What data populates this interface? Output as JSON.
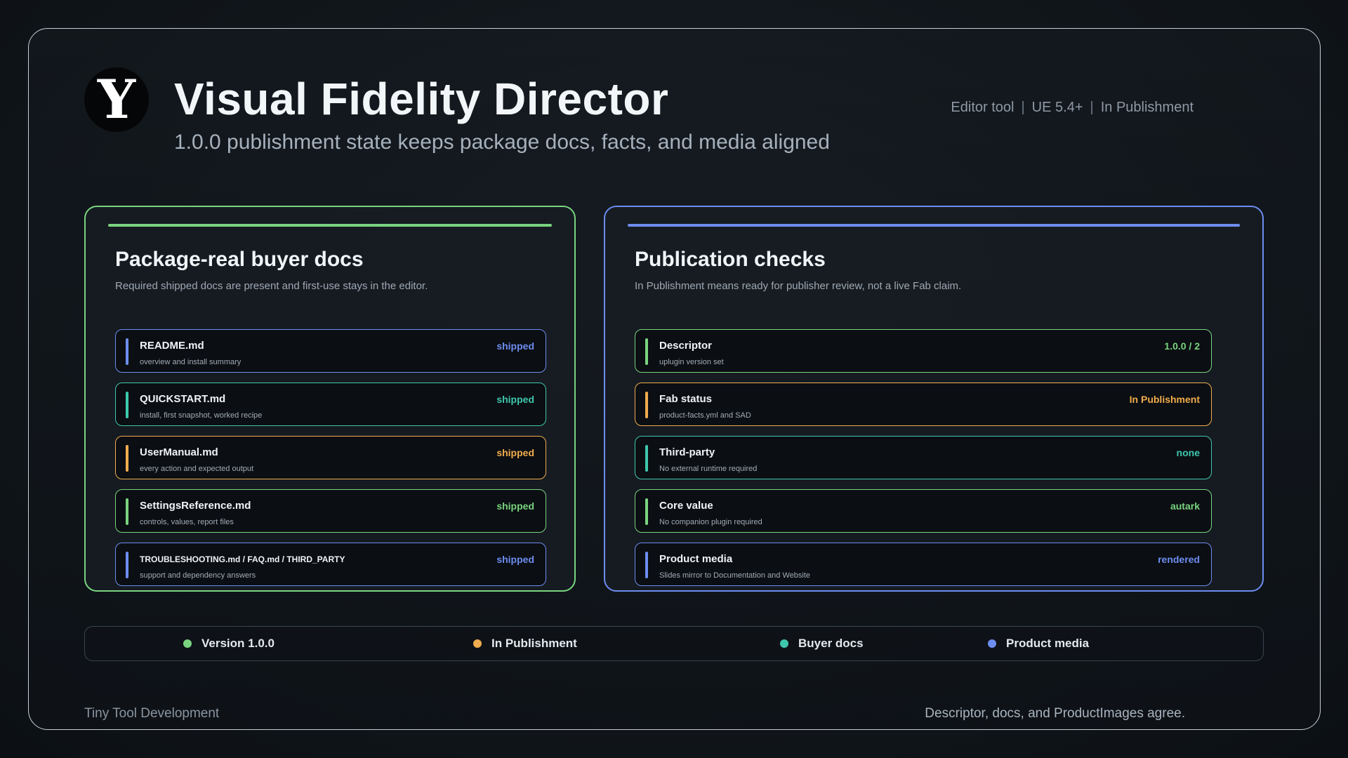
{
  "header": {
    "logo_letter": "Y",
    "title": "Visual Fidelity Director",
    "subtitle": "1.0.0 publishment state keeps package docs, facts, and media aligned",
    "meta": [
      "Editor tool",
      "UE 5.4+",
      "In Publishment"
    ],
    "meta_separator": "|"
  },
  "colors": {
    "green": "#79d47f",
    "blue": "#6d8df0",
    "orange": "#f0ac4e",
    "teal": "#3ec7ad"
  },
  "docs_panel": {
    "title": "Package-real buyer docs",
    "description": "Required shipped docs are present and first-use stays in the editor.",
    "rows": [
      {
        "name": "README.md",
        "sub": "overview and install summary",
        "status": "shipped",
        "color": "#6d8df0"
      },
      {
        "name": "QUICKSTART.md",
        "sub": "install, first snapshot, worked recipe",
        "status": "shipped",
        "color": "#3ec7ad"
      },
      {
        "name": "UserManual.md",
        "sub": "every action and expected output",
        "status": "shipped",
        "color": "#f0ac4e"
      },
      {
        "name": "SettingsReference.md",
        "sub": "controls, values, report files",
        "status": "shipped",
        "color": "#79d47f"
      },
      {
        "name": "TROUBLESHOOTING.md / FAQ.md / THIRD_PARTY",
        "sub": "support and dependency answers",
        "status": "shipped",
        "color": "#6d8df0",
        "small": true
      }
    ]
  },
  "checks_panel": {
    "title": "Publication checks",
    "description": "In Publishment means ready for publisher review, not a live Fab claim.",
    "rows": [
      {
        "name": "Descriptor",
        "sub": "uplugin version set",
        "status": "1.0.0 / 2",
        "color": "#79d47f"
      },
      {
        "name": "Fab status",
        "sub": "product-facts.yml and SAD",
        "status": "In Publishment",
        "color": "#f0ac4e"
      },
      {
        "name": "Third-party",
        "sub": "No external runtime required",
        "status": "none",
        "color": "#3ec7ad"
      },
      {
        "name": "Core value",
        "sub": "No companion plugin required",
        "status": "autark",
        "color": "#79d47f"
      },
      {
        "name": "Product media",
        "sub": "Slides mirror to Documentation and Website",
        "status": "rendered",
        "color": "#6d8df0"
      }
    ]
  },
  "legend": [
    {
      "label": "Version 1.0.0",
      "color": "#79d47f"
    },
    {
      "label": "In Publishment",
      "color": "#f0ac4e"
    },
    {
      "label": "Buyer docs",
      "color": "#3ec7ad"
    },
    {
      "label": "Product media",
      "color": "#6d8df0"
    }
  ],
  "footer": {
    "left": "Tiny Tool Development",
    "right": "Descriptor, docs, and ProductImages agree."
  }
}
